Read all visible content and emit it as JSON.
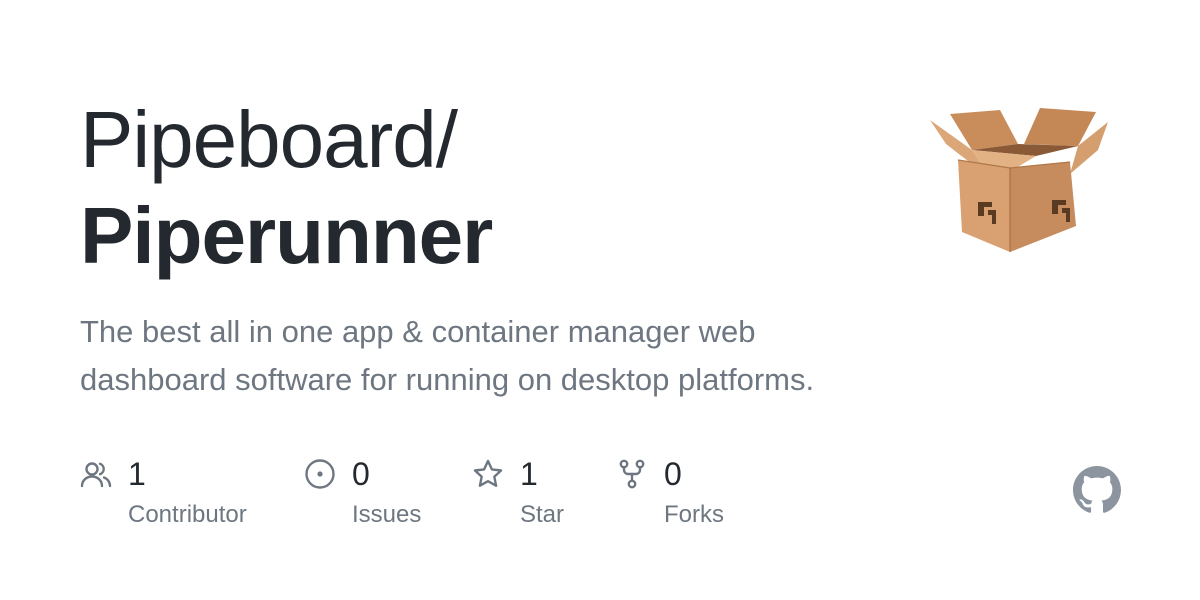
{
  "repo": {
    "owner": "Pipeboard/",
    "name": "Piperunner",
    "description": "The best all in one app & container manager web dashboard software for running on desktop platforms."
  },
  "stats": [
    {
      "icon": "people-icon",
      "value": "1",
      "label": "Contributor"
    },
    {
      "icon": "issue-icon",
      "value": "0",
      "label": "Issues"
    },
    {
      "icon": "star-icon",
      "value": "1",
      "label": "Star"
    },
    {
      "icon": "fork-icon",
      "value": "0",
      "label": "Forks"
    }
  ],
  "colors": {
    "title": "#24292f",
    "muted": "#6e7781",
    "icon": "#6e7781",
    "github_logo": "#8c959f",
    "box": "#d09868"
  },
  "images": {
    "repo_avatar": "package-box-icon",
    "brand": "github-logo-icon"
  }
}
